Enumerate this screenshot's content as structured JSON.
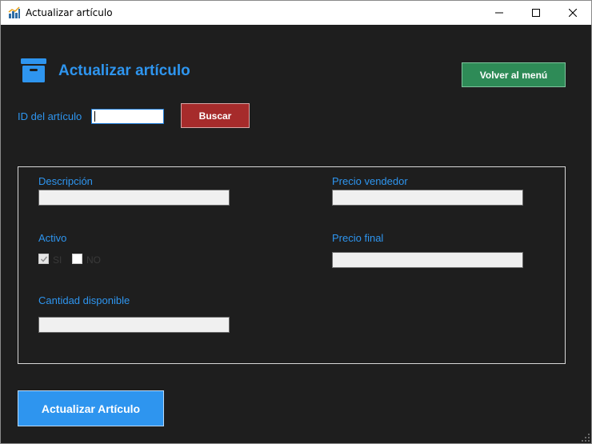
{
  "window": {
    "title": "Actualizar artículo",
    "controls": {
      "minimize_icon": "minimize-icon",
      "maximize_icon": "maximize-icon",
      "close_icon": "close-icon"
    }
  },
  "header": {
    "icon": "archive-box-icon",
    "title": "Actualizar artículo",
    "back_button": "Volver al menú"
  },
  "search": {
    "label": "ID del artículo",
    "value": "",
    "button": "Buscar"
  },
  "form": {
    "descripcion": {
      "label": "Descripción",
      "value": ""
    },
    "precio_vendedor": {
      "label": "Precio vendedor",
      "value": ""
    },
    "activo": {
      "label": "Activo",
      "options": [
        {
          "label": "SI",
          "checked": true
        },
        {
          "label": "NO",
          "checked": false
        }
      ]
    },
    "precio_final": {
      "label": "Precio final",
      "value": ""
    },
    "cantidad": {
      "label": "Cantidad disponible",
      "value": ""
    }
  },
  "actions": {
    "update_button": "Actualizar Artículo"
  },
  "colors": {
    "accent_blue": "#2e95ef",
    "back_green": "#2e8b57",
    "search_red": "#a62b2b",
    "background": "#1e1e1e"
  }
}
